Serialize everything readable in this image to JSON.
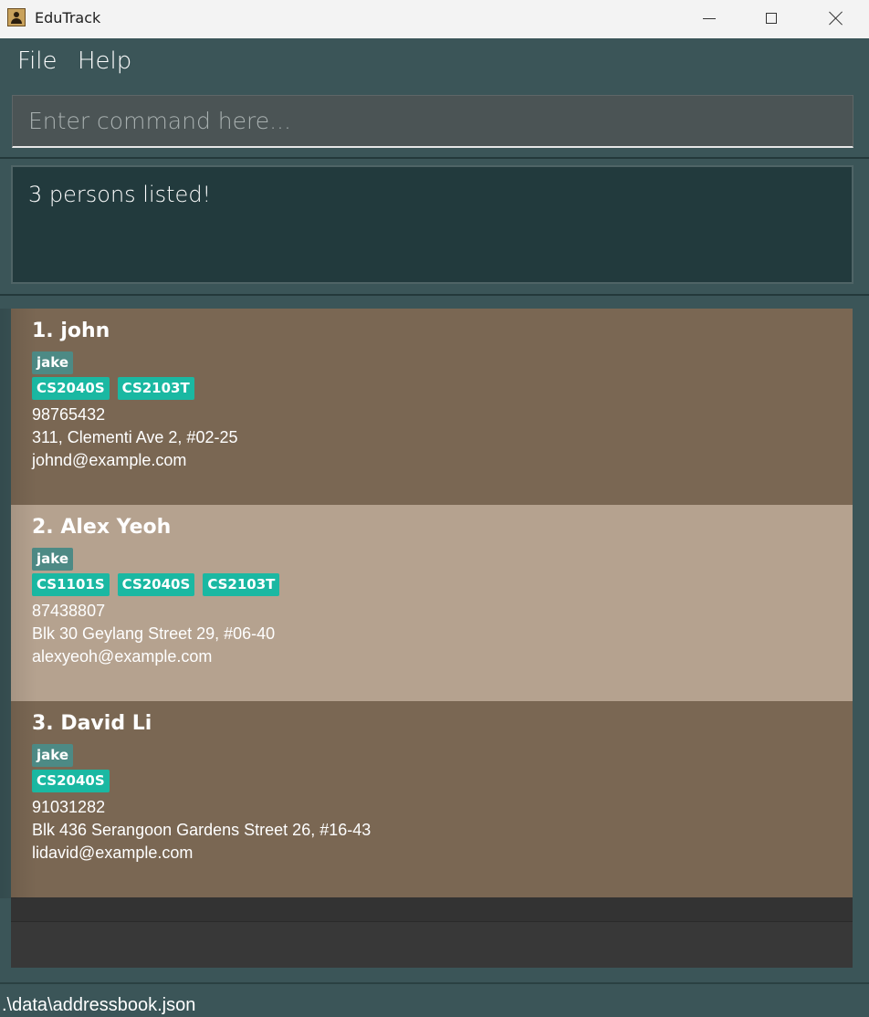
{
  "window": {
    "title": "EduTrack"
  },
  "menu": {
    "file": "File",
    "help": "Help"
  },
  "command": {
    "placeholder": "Enter command here...",
    "value": ""
  },
  "result": {
    "message": "3 persons listed!"
  },
  "persons": [
    {
      "title": "1. john",
      "group_tags": [
        "jake"
      ],
      "course_tags": [
        "CS2040S",
        "CS2103T"
      ],
      "phone": "98765432",
      "address": "311, Clementi Ave 2, #02-25",
      "email": "johnd@example.com"
    },
    {
      "title": "2. Alex Yeoh",
      "group_tags": [
        "jake"
      ],
      "course_tags": [
        "CS1101S",
        "CS2040S",
        "CS2103T"
      ],
      "phone": "87438807",
      "address": "Blk 30 Geylang Street 29, #06-40",
      "email": "alexyeoh@example.com"
    },
    {
      "title": "3. David Li",
      "group_tags": [
        "jake"
      ],
      "course_tags": [
        "CS2040S"
      ],
      "phone": "91031282",
      "address": "Blk 436 Serangoon Gardens Street 26, #16-43",
      "email": "lidavid@example.com"
    }
  ],
  "status": {
    "file_path": ".\\data\\addressbook.json"
  },
  "colors": {
    "background": "#3b5558",
    "card_dark": "#7a6753",
    "card_light": "#b5a28f",
    "group_tag": "#4d8a85",
    "course_tag": "#1ab8a2"
  }
}
